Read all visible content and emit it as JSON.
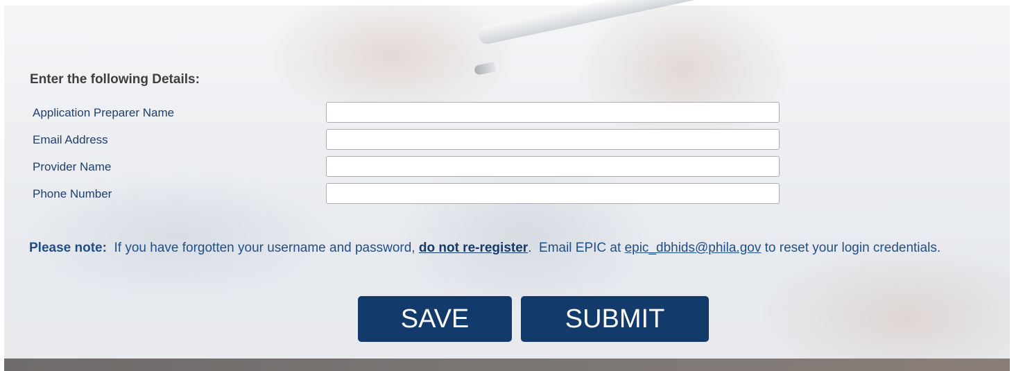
{
  "form": {
    "heading": "Enter the following Details:",
    "fields": [
      {
        "label": "Application Preparer Name",
        "value": "",
        "placeholder": ""
      },
      {
        "label": "Email Address",
        "value": "",
        "placeholder": ""
      },
      {
        "label": "Provider Name",
        "value": "",
        "placeholder": ""
      },
      {
        "label": "Phone Number",
        "value": "",
        "placeholder": ""
      }
    ]
  },
  "note": {
    "prefix": "Please note:",
    "text1": "If you have forgotten your username and password,",
    "warning_link": "do not re-register",
    "text2": ".  Email EPIC at",
    "email_link": "epic_dbhids@phila.gov",
    "text3": "to reset your login credentials."
  },
  "actions": {
    "save_label": "SAVE",
    "submit_label": "SUBMIT"
  },
  "colors": {
    "button_bg": "#123a6a",
    "label_text": "#20406b",
    "note_text": "#1f4f86",
    "heading_text": "#3f3f3f"
  }
}
